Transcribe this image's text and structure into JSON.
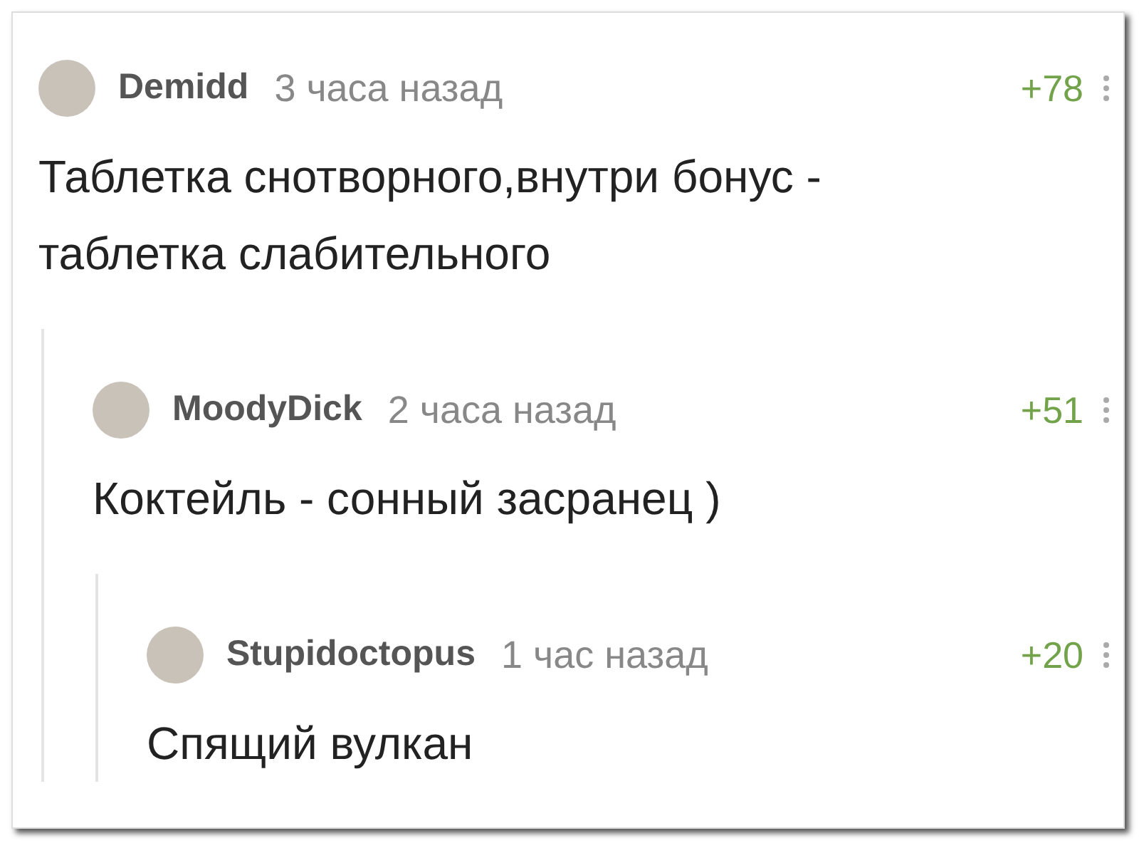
{
  "comments": [
    {
      "author": "Demidd",
      "time": "3 часа назад",
      "score": "+78",
      "text": "Таблетка снотворного,внутри бонус - таблетка слабительного",
      "children": [
        {
          "author": "MoodyDick",
          "time": "2 часа назад",
          "score": "+51",
          "text": "Коктейль - сонный засранец )",
          "children": [
            {
              "author": "Stupidoctopus",
              "time": "1 час назад",
              "score": "+20",
              "text": "Спящий вулкан"
            }
          ]
        }
      ]
    }
  ]
}
